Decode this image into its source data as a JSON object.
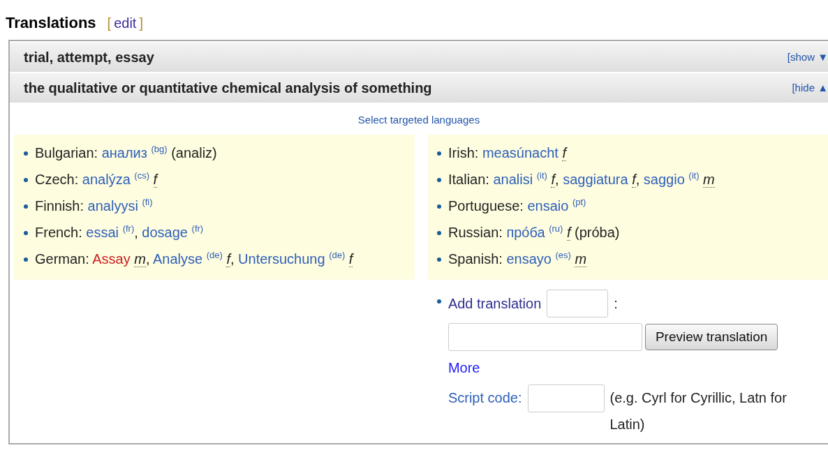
{
  "heading": {
    "title": "Translations",
    "bracket_open": "[",
    "edit_link": "edit",
    "bracket_close": "]"
  },
  "sections": [
    {
      "gloss": "trial, attempt, essay",
      "toggle": "[show ▼"
    },
    {
      "gloss": "the qualitative or quantitative chemical analysis of something",
      "toggle": "[hide ▲",
      "select_link": "Select targeted languages",
      "term_separator": ",",
      "columns": [
        [
          {
            "language": "Bulgarian:",
            "terms": [
              {
                "word": "анализ",
                "kind": "link",
                "code": "(bg)",
                "translit": "(analiz)"
              }
            ]
          },
          {
            "language": "Czech:",
            "terms": [
              {
                "word": "analýza",
                "kind": "link",
                "code": "(cs)",
                "gender": "f"
              }
            ]
          },
          {
            "language": "Finnish:",
            "terms": [
              {
                "word": "analyysi",
                "kind": "link",
                "code": "(fi)"
              }
            ]
          },
          {
            "language": "French:",
            "terms": [
              {
                "word": "essai",
                "kind": "link",
                "code": "(fr)"
              },
              {
                "word": "dosage",
                "kind": "link",
                "code": "(fr)"
              }
            ]
          },
          {
            "language": "German:",
            "terms": [
              {
                "word": "Assay",
                "kind": "redlink",
                "gender": "m"
              },
              {
                "word": "Analyse",
                "kind": "link",
                "code": "(de)",
                "gender": "f"
              },
              {
                "word": "Untersuchung",
                "kind": "link",
                "code": "(de)",
                "gender": "f"
              }
            ]
          }
        ],
        [
          {
            "language": "Irish:",
            "terms": [
              {
                "word": "measúnacht",
                "kind": "link",
                "gender": "f"
              }
            ]
          },
          {
            "language": "Italian:",
            "terms": [
              {
                "word": "analisi",
                "kind": "link",
                "code": "(it)",
                "gender": "f"
              },
              {
                "word": "saggiatura",
                "kind": "link",
                "gender": "f"
              },
              {
                "word": "saggio",
                "kind": "link",
                "code": "(it)",
                "gender": "m"
              }
            ]
          },
          {
            "language": "Portuguese:",
            "terms": [
              {
                "word": "ensaio",
                "kind": "link",
                "code": "(pt)"
              }
            ]
          },
          {
            "language": "Russian:",
            "terms": [
              {
                "word": "про́ба",
                "kind": "link",
                "code": "(ru)",
                "gender": "f",
                "translit": "(próba)"
              }
            ]
          },
          {
            "language": "Spanish:",
            "terms": [
              {
                "word": "ensayo",
                "kind": "link",
                "code": "(es)",
                "gender": "m"
              }
            ]
          }
        ]
      ],
      "add_form": {
        "label": "Add translation",
        "colon": ":",
        "button": "Preview translation",
        "more_link": "More",
        "script_label": "Script code:",
        "script_hint": "(e.g. Cyrl for Cyrillic, Latn for Latin)"
      }
    }
  ]
}
